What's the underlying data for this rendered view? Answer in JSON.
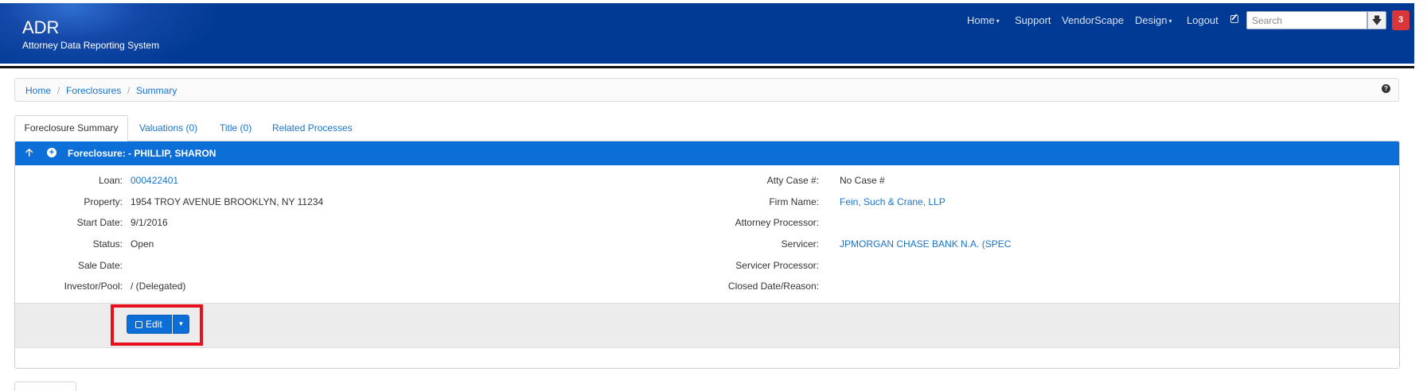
{
  "app": {
    "title": "ADR",
    "subtitle": "Attorney Data Reporting System"
  },
  "topnav": {
    "home": "Home",
    "support": "Support",
    "vendorscape": "VendorScape",
    "design": "Design",
    "logout": "Logout",
    "search_placeholder": "Search",
    "notification_count": "3"
  },
  "breadcrumb": [
    "Home",
    "Foreclosures",
    "Summary"
  ],
  "tabs": [
    "Foreclosure Summary",
    "Valuations (0)",
    "Title (0)",
    "Related Processes"
  ],
  "panel": {
    "title": "Foreclosure: - PHILLIP, SHARON",
    "left": [
      {
        "label": "Loan:",
        "value": "000422401"
      },
      {
        "label": "Property:",
        "value": "1954 TROY AVENUE BROOKLYN, NY 11234"
      },
      {
        "label": "Start Date:",
        "value": "9/1/2016"
      },
      {
        "label": "Status:",
        "value": "Open"
      },
      {
        "label": "Sale Date:",
        "value": ""
      },
      {
        "label": "Investor/Pool:",
        "value": "/ (Delegated)"
      }
    ],
    "right": [
      {
        "label": "Atty Case #:",
        "value": "No Case #"
      },
      {
        "label": "Firm Name:",
        "value": "Fein, Such & Crane, LLP"
      },
      {
        "label": "Attorney Processor:",
        "value": ""
      },
      {
        "label": "Servicer:",
        "value": "JPMORGAN CHASE BANK N.A. (SPEC"
      },
      {
        "label": "Servicer Processor:",
        "value": ""
      },
      {
        "label": "Closed Date/Reason:",
        "value": ""
      }
    ],
    "edit_label": "Edit"
  },
  "colors": {
    "header_blue": "#003a94",
    "panel_head_blue": "#0b6fd7",
    "link_blue": "#1a73c8",
    "highlight_red": "#e8101d",
    "badge_red": "#d9363a"
  },
  "icons": [
    "edit-icon",
    "download-icon",
    "help-icon",
    "arrow-up-icon",
    "plus-circle-icon",
    "chevron-down-icon"
  ]
}
